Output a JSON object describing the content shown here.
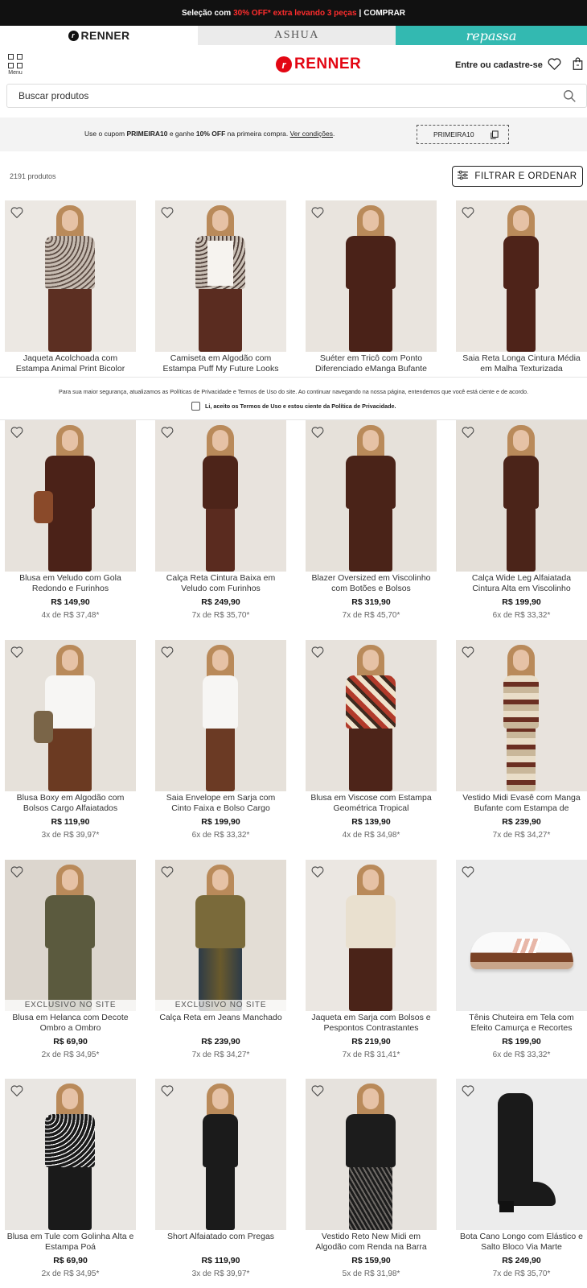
{
  "promo_bar": {
    "prefix": "Seleção com",
    "highlight": "30% OFF* extra levando 3 peças",
    "separator": " | ",
    "cta": "COMPRAR"
  },
  "brand_tabs": [
    {
      "label": "RENNER",
      "icon": "renner-r-icon"
    },
    {
      "label": "ASHUA"
    },
    {
      "label": "repassa"
    }
  ],
  "header": {
    "menu_label": "Menu",
    "logo_text": "RENNER",
    "login_label": "Entre ou cadastre-se",
    "icons": [
      "menu-grid-icon",
      "heart-icon",
      "bag-icon"
    ]
  },
  "search": {
    "placeholder": "Buscar produtos",
    "icon": "search-icon"
  },
  "coupon": {
    "text_pre": "Use o cupom ",
    "code_inline": "PRIMEIRA10",
    "text_mid": " e ganhe ",
    "discount": "10% OFF",
    "text_post": " na primeira compra. ",
    "link": "Ver condições",
    "link_suffix": ".",
    "code_button": "PRIMEIRA10",
    "icon": "copy-icon"
  },
  "listing": {
    "count": "2191 produtos",
    "filter_label": "FILTRAR E ORDENAR",
    "filter_icon": "sliders-icon"
  },
  "cookie_banner": {
    "message": "Para sua maior segurança, atualizamos as Políticas de Privacidade e Termos de Uso do site. Ao continuar navegando na nossa página, entendemos que você está ciente e de acordo.",
    "checkbox_label": "Li, aceito os Termos de Uso e estou ciente da Política de Privacidade."
  },
  "colors": {
    "brand_red": "#e30613",
    "promo_red": "#ff2d2d",
    "repassa_teal": "#33b9b1",
    "topbar_bg": "#111111"
  },
  "products": [
    {
      "name": "Jaqueta Acolchoada com Estampa Animal Print Bicolor",
      "price": "",
      "installments": "",
      "badge": "",
      "img": "model-leopard-quilted-jacket"
    },
    {
      "name": "Camiseta em Algodão com Estampa Puff My Future Looks Great",
      "price": "",
      "installments": "",
      "badge": "",
      "img": "model-white-tee-jacket"
    },
    {
      "name": "Suéter em Tricô com Ponto Diferenciado eManga Bufante",
      "price": "",
      "installments": "",
      "badge": "",
      "img": "model-brown-sweater"
    },
    {
      "name": "Saia Reta Longa Cintura Média em Malha Texturizada",
      "price": "",
      "installments": "",
      "badge": "",
      "img": "model-brown-long-skirt"
    },
    {
      "name": "Blusa em Veludo com Gola Redondo e Furinhos",
      "price": "R$ 149,90",
      "installments": "4x de R$ 37,48*",
      "badge": "",
      "img": "model-velvet-blouse"
    },
    {
      "name": "Calça Reta Cintura Baixa em Veludo com Furinhos",
      "price": "R$ 249,90",
      "installments": "7x de R$ 35,70*",
      "badge": "",
      "img": "model-velvet-pants"
    },
    {
      "name": "Blazer Oversized em Viscolinho com Botões e Bolsos",
      "price": "R$ 319,90",
      "installments": "7x de R$ 45,70*",
      "badge": "",
      "img": "model-brown-blazer-seated"
    },
    {
      "name": "Calça Wide Leg Alfaiatada Cintura Alta em Viscolinho",
      "price": "R$ 199,90",
      "installments": "6x de R$ 33,32*",
      "badge": "",
      "img": "model-brown-suit"
    },
    {
      "name": "Blusa Boxy em Algodão com Bolsos Cargo Alfaiatados",
      "price": "R$ 119,90",
      "installments": "3x de R$ 39,97*",
      "badge": "",
      "img": "model-white-boxy-blouse"
    },
    {
      "name": "Saia Envelope em Sarja com Cinto Faixa e Bolso Cargo",
      "price": "R$ 199,90",
      "installments": "6x de R$ 33,32*",
      "badge": "",
      "img": "model-wrap-skirt"
    },
    {
      "name": "Blusa em Viscose com Estampa Geométrica Tropical",
      "price": "R$ 139,90",
      "installments": "4x de R$ 34,98*",
      "badge": "",
      "img": "model-geometric-print-blouse"
    },
    {
      "name": "Vestido Midi Evasê com Manga Bufante com Estampa de Patchwork",
      "price": "R$ 239,90",
      "installments": "7x de R$ 34,27*",
      "badge": "",
      "img": "model-patchwork-dress"
    },
    {
      "name": "Blusa em Helanca com Decote Ombro a Ombro",
      "price": "R$ 69,90",
      "installments": "2x de R$ 34,95*",
      "badge": "EXCLUSIVO NO SITE",
      "img": "model-olive-off-shoulder"
    },
    {
      "name": "Calça Reta em Jeans Manchado",
      "price": "R$ 239,90",
      "installments": "7x de R$ 34,27*",
      "badge": "EXCLUSIVO NO SITE",
      "img": "model-stained-jeans"
    },
    {
      "name": "Jaqueta em Sarja com Bolsos e Pespontos Contrastantes",
      "price": "R$ 219,90",
      "installments": "7x de R$ 31,41*",
      "badge": "",
      "img": "model-cream-jacket"
    },
    {
      "name": "Tênis Chuteira em Tela com Efeito Camurça e Recortes",
      "price": "R$ 199,90",
      "installments": "6x de R$ 33,32*",
      "badge": "",
      "img": "sneaker-white-brown"
    },
    {
      "name": "Blusa em Tule com Golinha Alta e Estampa Poá",
      "price": "R$ 69,90",
      "installments": "2x de R$ 34,95*",
      "badge": "",
      "img": "model-tulle-polka-blouse"
    },
    {
      "name": "Short Alfaiatado com Pregas",
      "price": "R$ 119,90",
      "installments": "3x de R$ 39,97*",
      "badge": "",
      "img": "model-black-shorts"
    },
    {
      "name": "Vestido Reto New Midi em Algodão com Renda na Barra",
      "price": "R$ 159,90",
      "installments": "5x de R$ 31,98*",
      "badge": "",
      "img": "model-black-lace-dress"
    },
    {
      "name": "Bota Cano Longo com Elástico e Salto Bloco Via Marte",
      "price": "R$ 249,90",
      "installments": "7x de R$ 35,70*",
      "badge": "",
      "img": "black-knee-boot"
    }
  ]
}
